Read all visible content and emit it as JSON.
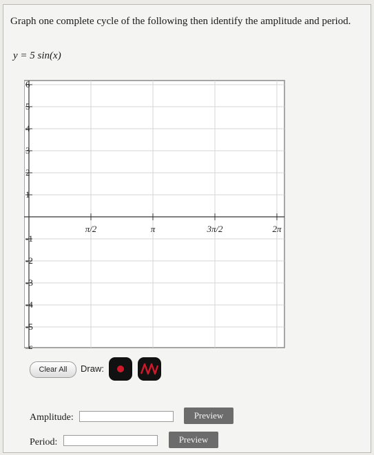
{
  "question": {
    "prompt": "Graph one complete cycle of the following then identify the amplitude and period.",
    "equation": "y = 5 sin(x)"
  },
  "graph": {
    "y_ticks": [
      "6",
      "5",
      "4",
      "3",
      "2",
      "1",
      "-1",
      "-2",
      "-3",
      "-4",
      "-5",
      "-6"
    ],
    "x_ticks": [
      "π/2",
      "π",
      "3π/2",
      "2π"
    ],
    "grid": true
  },
  "toolbar": {
    "clear_label": "Clear All",
    "draw_label": "Draw:",
    "tools": [
      {
        "name": "point-tool",
        "icon": "dot-icon",
        "color": "#cc1a2a"
      },
      {
        "name": "sine-tool",
        "icon": "sine-wave-icon",
        "color": "#cc1a2a"
      }
    ]
  },
  "answers": {
    "amplitude_label": "Amplitude:",
    "amplitude_value": "",
    "period_label": "Period:",
    "period_value": "",
    "preview_label": "Preview"
  }
}
